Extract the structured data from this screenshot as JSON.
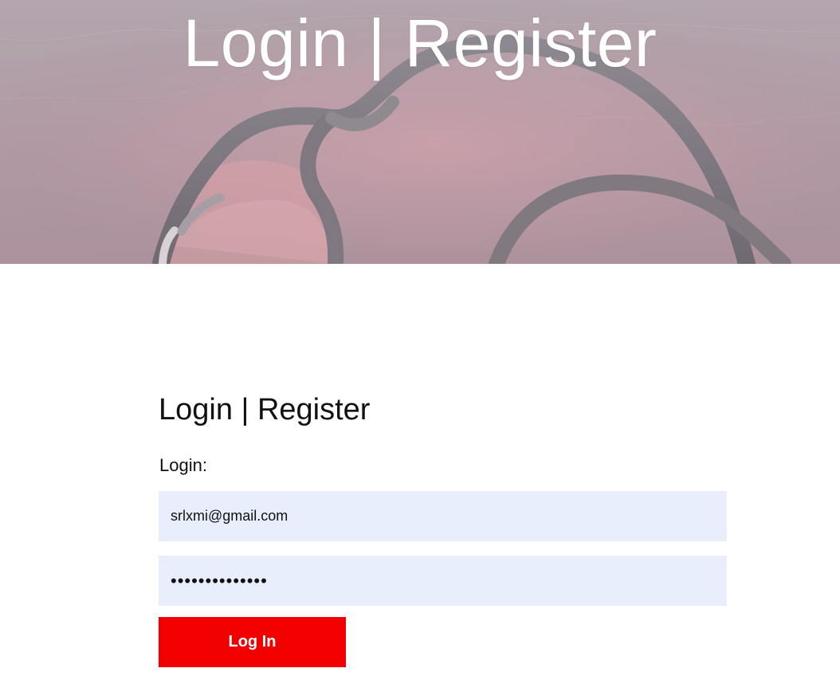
{
  "hero": {
    "title": "Login | Register"
  },
  "form": {
    "title": "Login | Register",
    "login_label": "Login:",
    "email_value": "srlxmi@gmail.com",
    "password_value": "••••••••••••••",
    "submit_label": "Log In"
  },
  "colors": {
    "accent": "#f20000",
    "field_background": "#e8eefb"
  },
  "icons": {
    "hero_image": "stethoscope-image"
  }
}
